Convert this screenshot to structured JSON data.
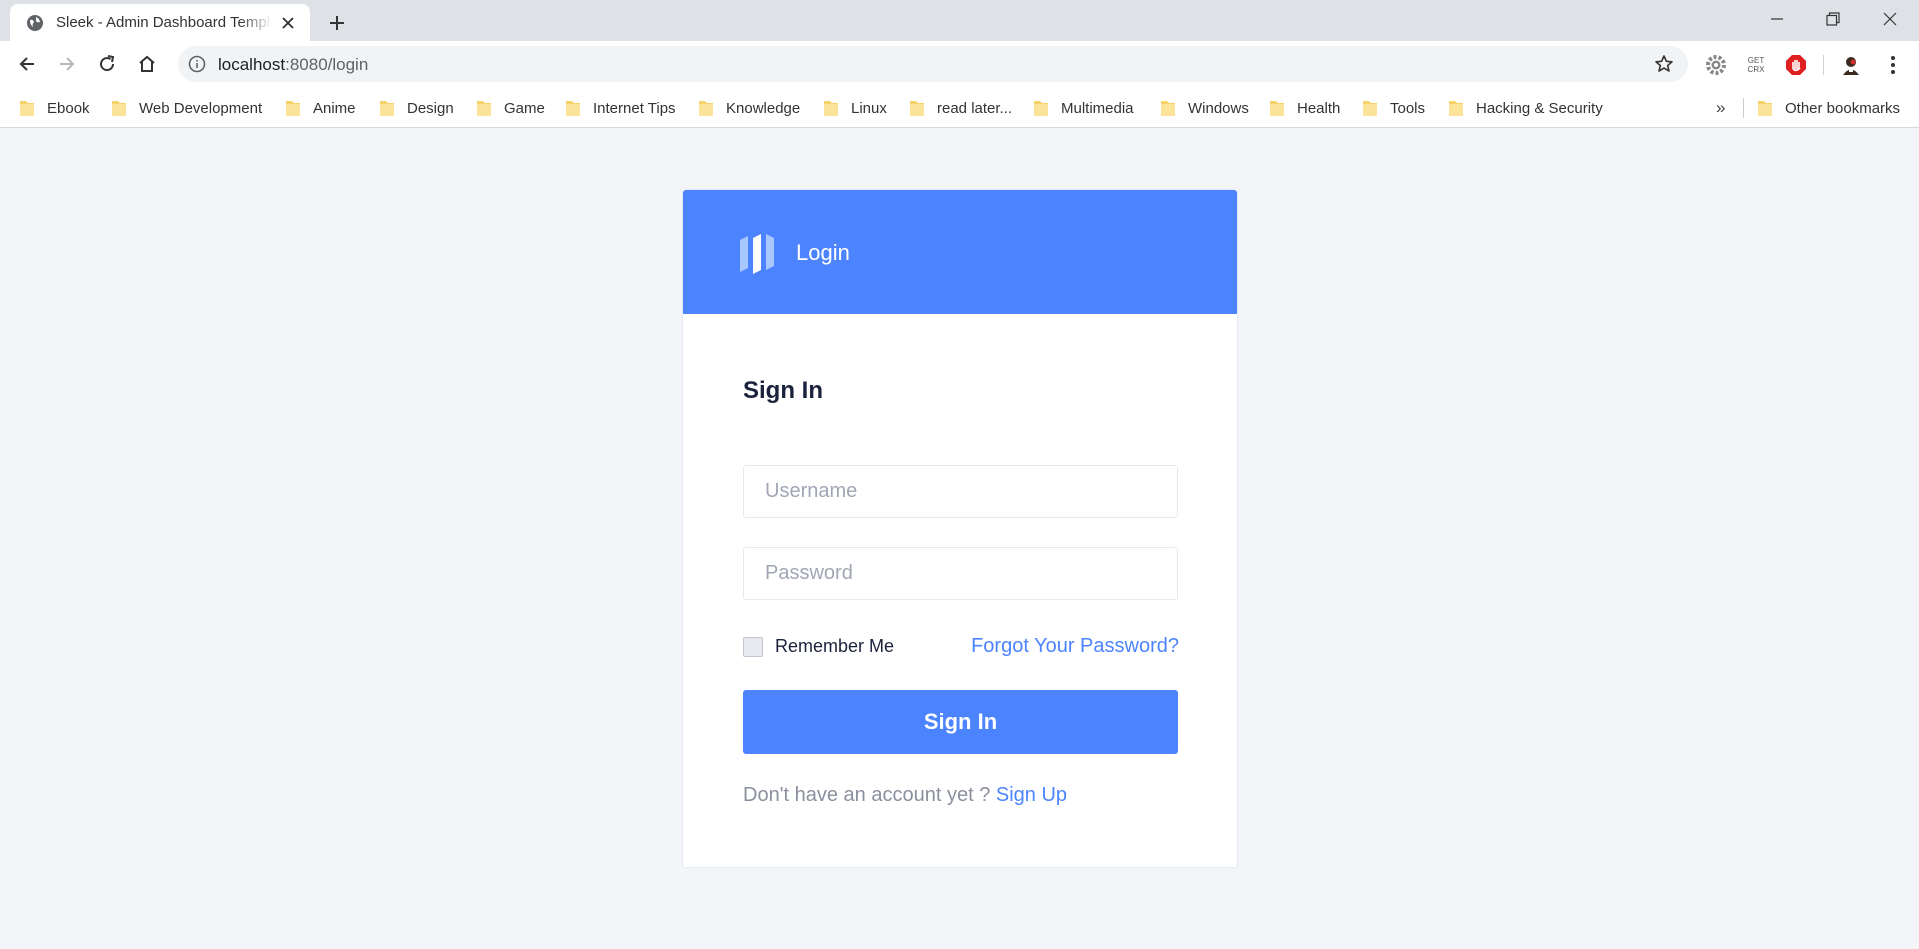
{
  "browser": {
    "tab_title": "Sleek - Admin Dashboard Template",
    "url_host": "localhost",
    "url_path": ":8080/login",
    "extensions": [
      "settings-gear-extension",
      "get-crx-extension",
      "adblock-extension",
      "profile-avatar"
    ],
    "extension_labels": {
      "get_crx_top": "GET",
      "get_crx_bottom": "CRX"
    },
    "bookmarks": [
      "Ebook",
      "Web Development",
      "Anime",
      "Design",
      "Game",
      "Internet Tips",
      "Knowledge",
      "Linux",
      "read later...",
      "Multimedia",
      "Windows",
      "Health",
      "Tools",
      "Hacking & Security"
    ],
    "bookmarks_more": "»",
    "other_bookmarks": "Other bookmarks"
  },
  "card": {
    "brand": "Login",
    "title": "Sign In",
    "username_placeholder": "Username",
    "password_placeholder": "Password",
    "remember_label": "Remember Me",
    "forgot_link": "Forgot Your Password?",
    "signin_button": "Sign In",
    "no_account_text": "Don't have an account yet ? ",
    "signup_link": "Sign Up"
  },
  "colors": {
    "accent": "#4c84ff",
    "page_bg": "#f4f5f9",
    "title_text": "#1b223c"
  }
}
